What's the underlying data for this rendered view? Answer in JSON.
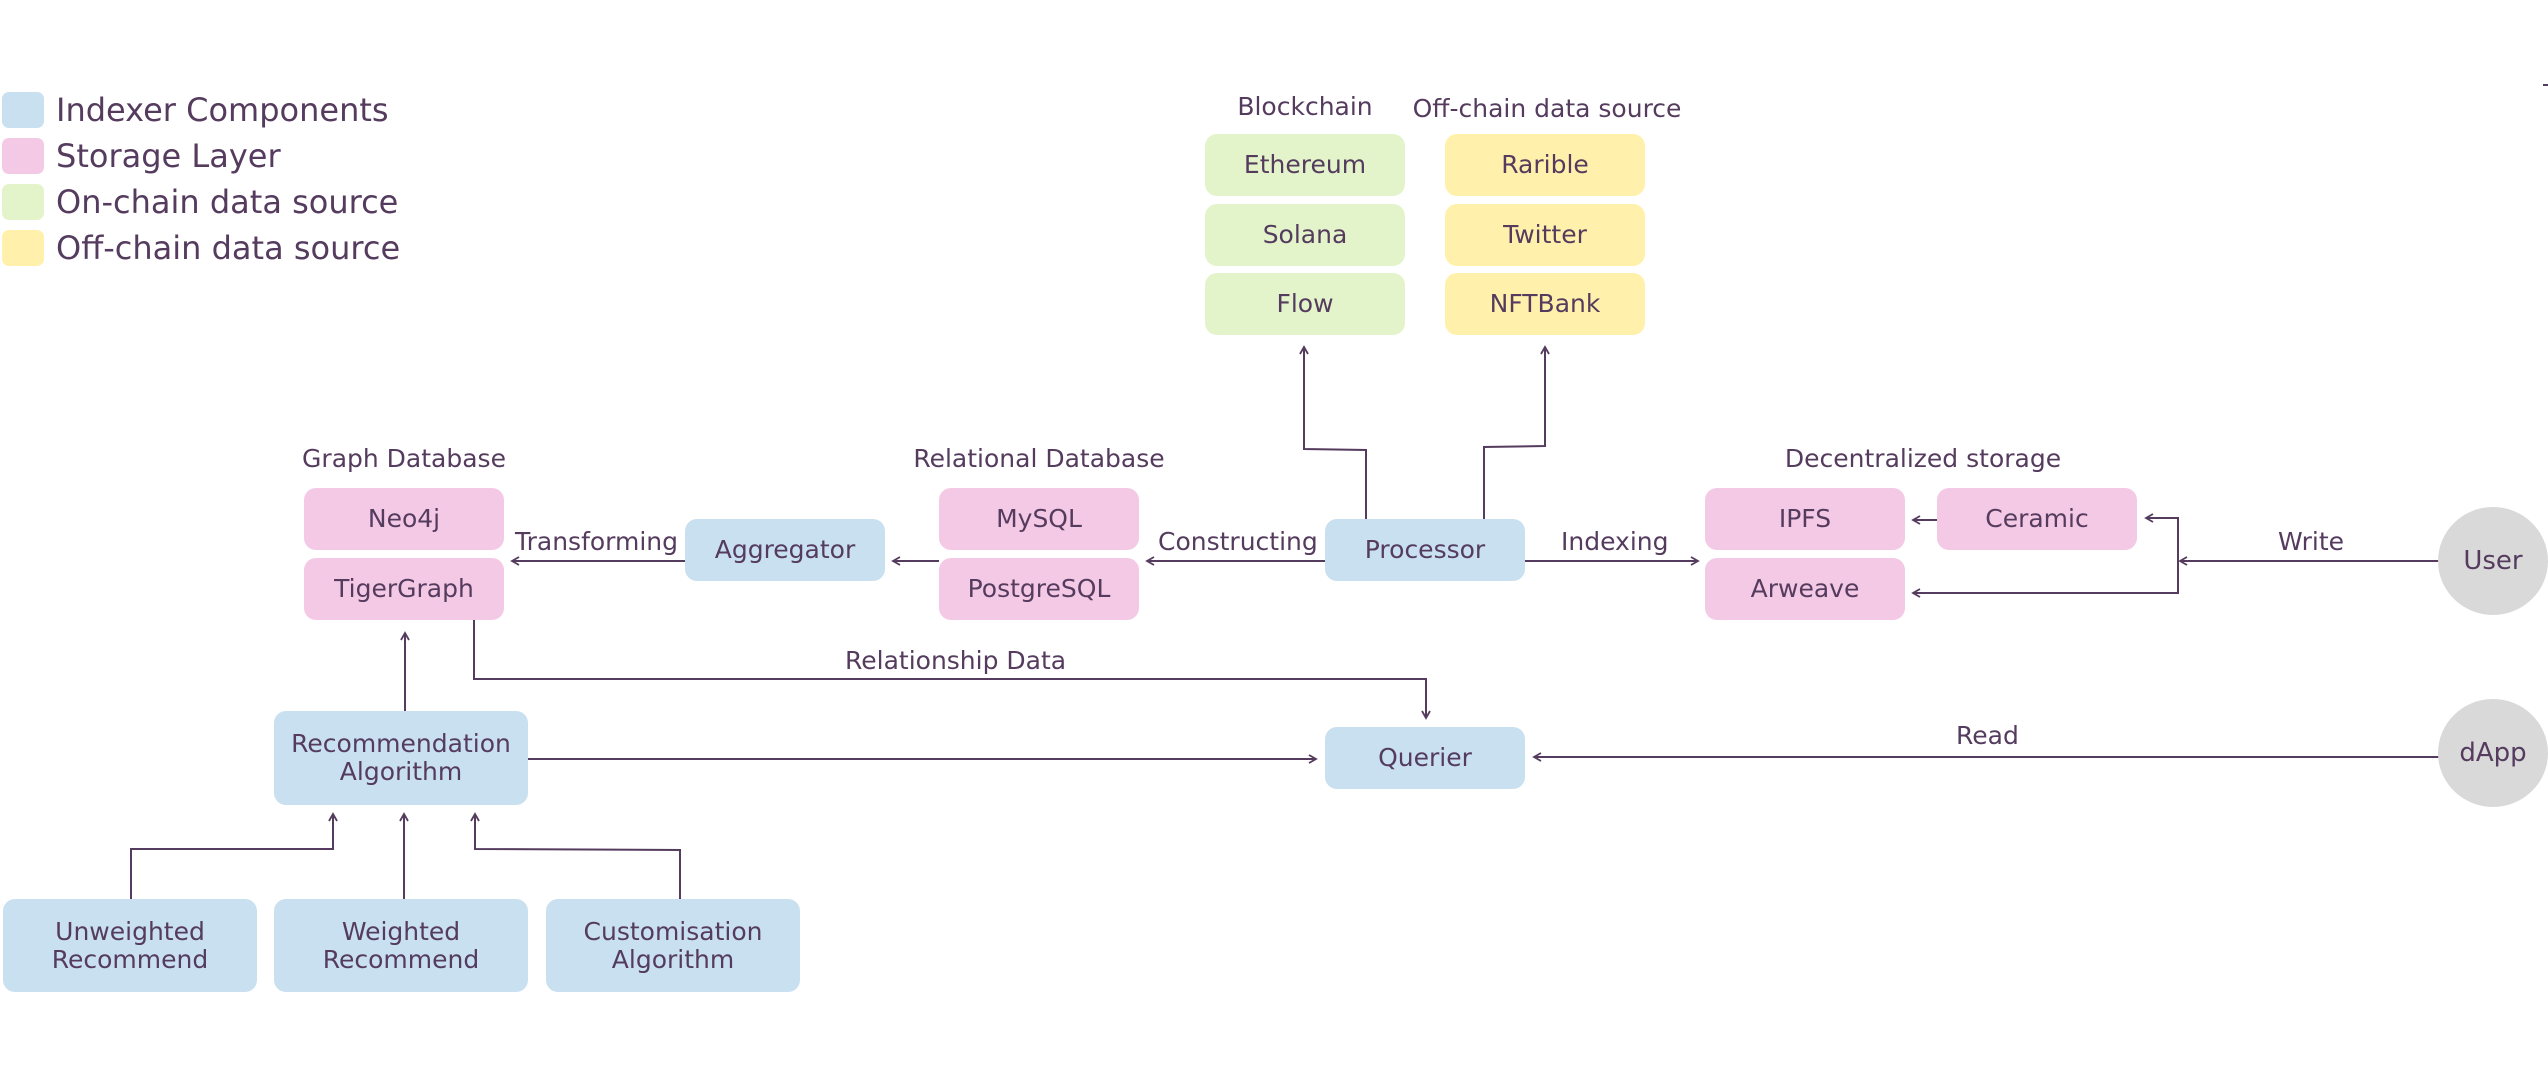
{
  "legend": [
    {
      "label": "Indexer Components",
      "color": "#c8e0ef"
    },
    {
      "label": "Storage Layer",
      "color": "#f4c9e5"
    },
    {
      "label": "On-chain data source",
      "color": "#e3f4cb"
    },
    {
      "label": "Off-chain data source",
      "color": "#fff1ab"
    }
  ],
  "groups": {
    "blockchain": "Blockchain",
    "offchain": "Off-chain data source",
    "graph_db": "Graph Database",
    "relational_db": "Relational Database",
    "decentralized": "Decentralized storage"
  },
  "nodes": {
    "ethereum": "Ethereum",
    "solana": "Solana",
    "flow": "Flow",
    "rarible": "Rarible",
    "twitter": "Twitter",
    "nftbank": "NFTBank",
    "neo4j": "Neo4j",
    "tigergraph": "TigerGraph",
    "aggregator": "Aggregator",
    "mysql": "MySQL",
    "postgresql": "PostgreSQL",
    "processor": "Processor",
    "ipfs": "IPFS",
    "ceramic": "Ceramic",
    "arweave": "Arweave",
    "user": "User",
    "dapp": "dApp",
    "querier": "Querier",
    "recommendation_line1": "Recommendation",
    "recommendation_line2": "Algorithm",
    "unweighted_line1": "Unweighted",
    "unweighted_line2": "Recommend",
    "weighted_line1": "Weighted",
    "weighted_line2": "Recommend",
    "customisation_line1": "Customisation",
    "customisation_line2": "Algorithm"
  },
  "edges": {
    "transforming": "Transforming",
    "constructing": "Constructing",
    "indexing": "Indexing",
    "write": "Write",
    "read": "Read",
    "relationship_data": "Relationship Data"
  },
  "colors": {
    "line": "#553c5e",
    "text": "#553c5e",
    "actor": "#d9d9d9"
  }
}
